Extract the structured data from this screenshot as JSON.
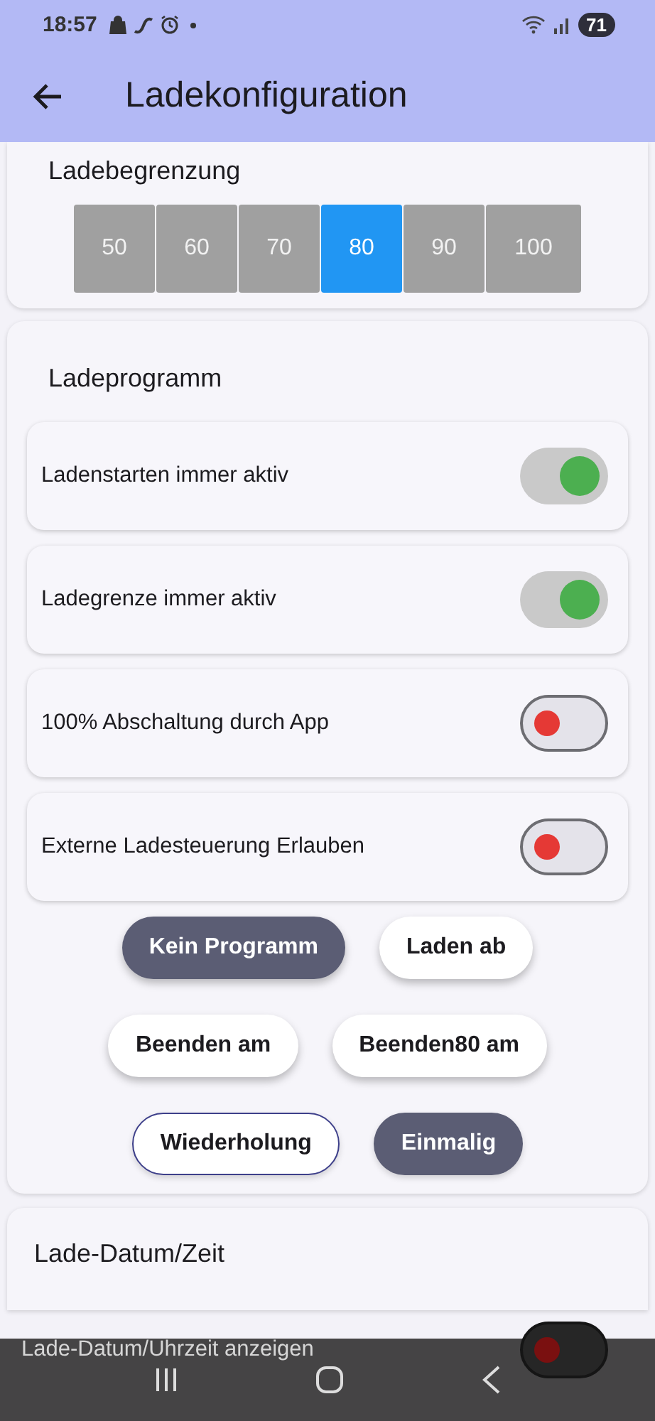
{
  "status_bar": {
    "time": "18:57",
    "battery": "71"
  },
  "app_bar": {
    "title": "Ladekonfiguration"
  },
  "charge_limit": {
    "title": "Ladebegrenzung",
    "options": [
      {
        "label": "50",
        "selected": false
      },
      {
        "label": "60",
        "selected": false
      },
      {
        "label": "70",
        "selected": false
      },
      {
        "label": "80",
        "selected": true
      },
      {
        "label": "90",
        "selected": false
      },
      {
        "label": "100",
        "selected": false
      }
    ]
  },
  "program": {
    "title": "Ladeprogramm",
    "switches": [
      {
        "label": "Ladenstarten immer aktiv",
        "on": true
      },
      {
        "label": "Ladegrenze immer aktiv",
        "on": true
      },
      {
        "label": "100% Abschaltung durch App",
        "on": false
      },
      {
        "label": "Externe Ladesteuerung Erlauben",
        "on": false
      }
    ],
    "program_buttons": [
      {
        "label": "Kein Programm",
        "selected": true
      },
      {
        "label": "Laden ab",
        "selected": false
      },
      {
        "label": "Beenden am",
        "selected": false
      },
      {
        "label": "Beenden80 am",
        "selected": false
      }
    ],
    "repeat_buttons": [
      {
        "label": "Wiederholung",
        "selected": false
      },
      {
        "label": "Einmalig",
        "selected": true
      }
    ]
  },
  "date_time": {
    "title": "Lade-Datum/Zeit",
    "switches": [
      {
        "label": "Lade-Datum/Uhrzeit anzeigen",
        "on": false
      }
    ]
  }
}
